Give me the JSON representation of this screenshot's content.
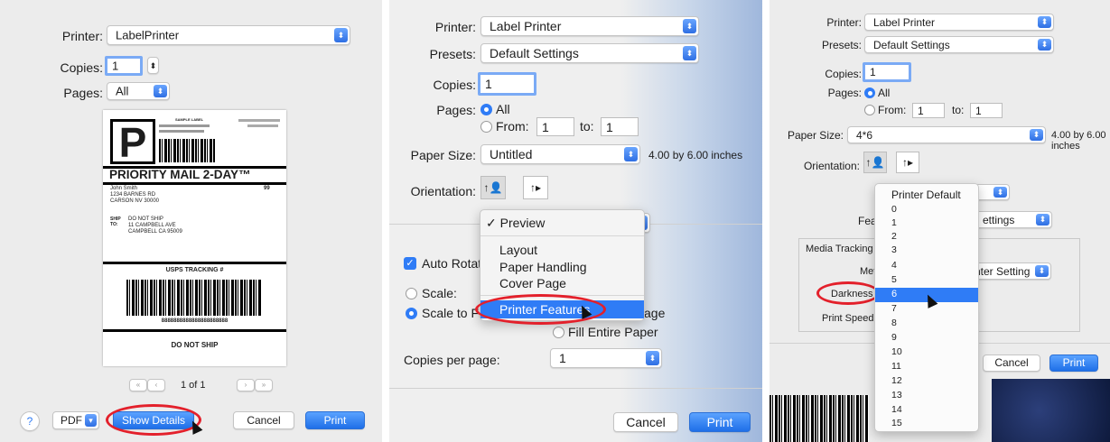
{
  "panel1": {
    "printer_label": "Printer:",
    "printer_value": "LabelPrinter",
    "copies_label": "Copies:",
    "copies_value": "1",
    "pages_label": "Pages:",
    "pages_value": "All",
    "preview": {
      "big_letter": "P",
      "header_small": "SAMPLE LABEL",
      "service": "PRIORITY MAIL 2-DAY™",
      "from_lines": [
        "John Smith",
        "1234 BARNES RD",
        "CARSON NV 30000"
      ],
      "zone": "99",
      "ship_to_label": "SHIP TO:",
      "to_lines": [
        "DO NOT SHIP",
        "11 CAMPBELL AVE",
        "CAMPBELL CA 95009"
      ],
      "tracking_title": "USPS TRACKING #",
      "tracking_number": "8888888888888888888888",
      "footer": "DO NOT SHIP"
    },
    "pager": "1 of 1",
    "help": "?",
    "pdf": "PDF",
    "show_details": "Show Details",
    "cancel": "Cancel",
    "print": "Print"
  },
  "panel2": {
    "printer_label": "Printer:",
    "printer_value": "Label Printer",
    "presets_label": "Presets:",
    "presets_value": "Default Settings",
    "copies_label": "Copies:",
    "copies_value": "1",
    "pages_label": "Pages:",
    "all_label": "All",
    "from_label": "From:",
    "from_value": "1",
    "to_label": "to:",
    "to_value": "1",
    "paper_size_label": "Paper Size:",
    "paper_size_value": "Untitled",
    "paper_size_dims": "4.00 by 6.00 inches",
    "orientation_label": "Orientation:",
    "menu": {
      "checked": "✓ Preview",
      "items": [
        "Layout",
        "Paper Handling",
        "Cover Page"
      ],
      "highlighted": "Printer Features"
    },
    "auto_rotate": "Auto Rotate",
    "scale": "Scale:",
    "scale_to_fit": "Scale to Fi",
    "page_fragment": "age",
    "fill_entire": "Fill Entire Paper",
    "copies_per_page_label": "Copies per page:",
    "copies_per_page_value": "1",
    "cancel": "Cancel",
    "print": "Print"
  },
  "panel3": {
    "printer_label": "Printer:",
    "printer_value": "Label Printer",
    "presets_label": "Presets:",
    "presets_value": "Default Settings",
    "copies_label": "Copies:",
    "copies_value": "1",
    "pages_label": "Pages:",
    "all_label": "All",
    "from_label": "From:",
    "from_value": "1",
    "to_label": "to:",
    "to_value": "1",
    "paper_size_label": "Paper Size:",
    "paper_size_value": "4*6",
    "paper_size_dims": "4.00 by 6.00 inches",
    "orientation_label": "Orientation:",
    "feature_fragment": "Fea",
    "settings_fragment": "ettings",
    "media_tracking": "Media Tracking",
    "method_label": "Method",
    "method_fragment": "nter Setting",
    "darkness_label": "Darkness",
    "print_speed_label": "Print Speed",
    "darkness_menu": {
      "first": "Printer Default",
      "items": [
        "0",
        "1",
        "2",
        "3",
        "4",
        "5",
        "6",
        "7",
        "8",
        "9",
        "10",
        "11",
        "12",
        "13",
        "14",
        "15"
      ],
      "selected": "6"
    },
    "cancel": "Cancel",
    "print": "Print"
  }
}
